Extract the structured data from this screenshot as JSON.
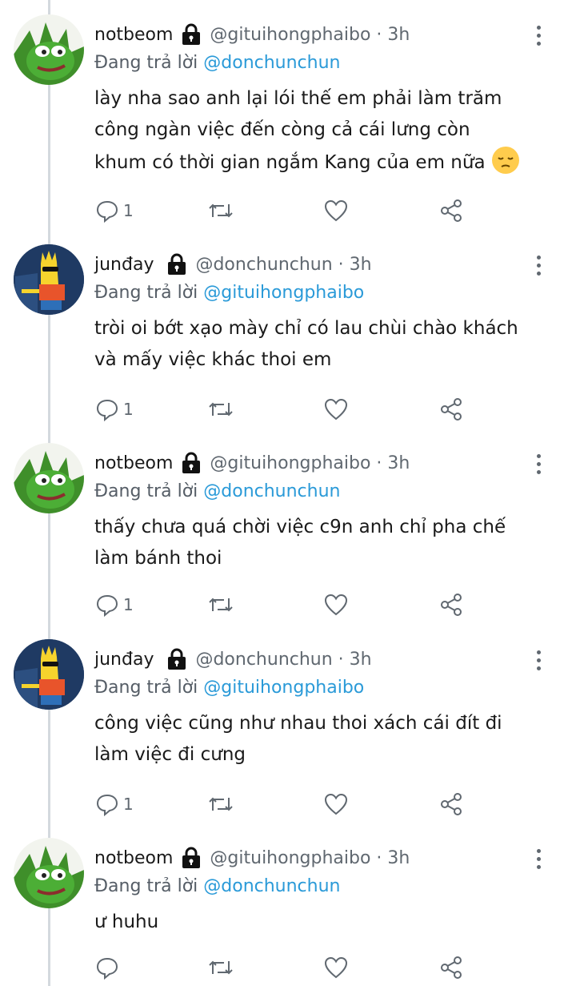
{
  "tweets": [
    {
      "name": "notbeom",
      "handle": "@gituihongphaibo · 3h",
      "reply_label": "Đang trả lời",
      "reply_to": "@donchunchun",
      "lines": [
        "lày nha sao anh lại lói thế em phải làm trăm",
        "công ngàn việc đến còng cả cái lưng còn",
        "khum có thời gian ngắm Kang của em nữa"
      ],
      "emoji": "pensive-face",
      "reply_count": "1",
      "avatar": "pepe"
    },
    {
      "name": "junđay",
      "handle": "@donchunchun · 3h",
      "reply_label": "Đang trả lời",
      "reply_to": "@gituihongphaibo",
      "lines": [
        "tròi oi bớt xạo mày chỉ có lau chùi chào khách",
        "và mấy việc khác thoi em"
      ],
      "reply_count": "1",
      "avatar": "bart"
    },
    {
      "name": "notbeom",
      "handle": "@gituihongphaibo · 3h",
      "reply_label": "Đang trả lời",
      "reply_to": "@donchunchun",
      "lines": [
        "thấy chưa quá chời việc c9n anh chỉ pha chế",
        "làm bánh thoi"
      ],
      "reply_count": "1",
      "avatar": "pepe"
    },
    {
      "name": "junđay",
      "handle": "@donchunchun · 3h",
      "reply_label": "Đang trả lời",
      "reply_to": "@gituihongphaibo",
      "lines": [
        "công việc cũng như nhau thoi xách cái đít đi",
        "làm việc đi cưng"
      ],
      "reply_count": "1",
      "avatar": "bart"
    },
    {
      "name": "notbeom",
      "handle": "@gituihongphaibo · 3h",
      "reply_label": "Đang trả lời",
      "reply_to": "@donchunchun",
      "lines": [
        "ư huhu"
      ],
      "reply_count": "",
      "avatar": "pepe"
    }
  ],
  "icons": {
    "lock": "lock-icon",
    "reply": "reply-icon",
    "retweet": "retweet-icon",
    "like": "heart-icon",
    "share": "share-icon",
    "more": "more-vertical-icon"
  },
  "colors": {
    "mention": "#2a9ad8",
    "muted": "#606870",
    "thread_line": "#d4d9de"
  }
}
